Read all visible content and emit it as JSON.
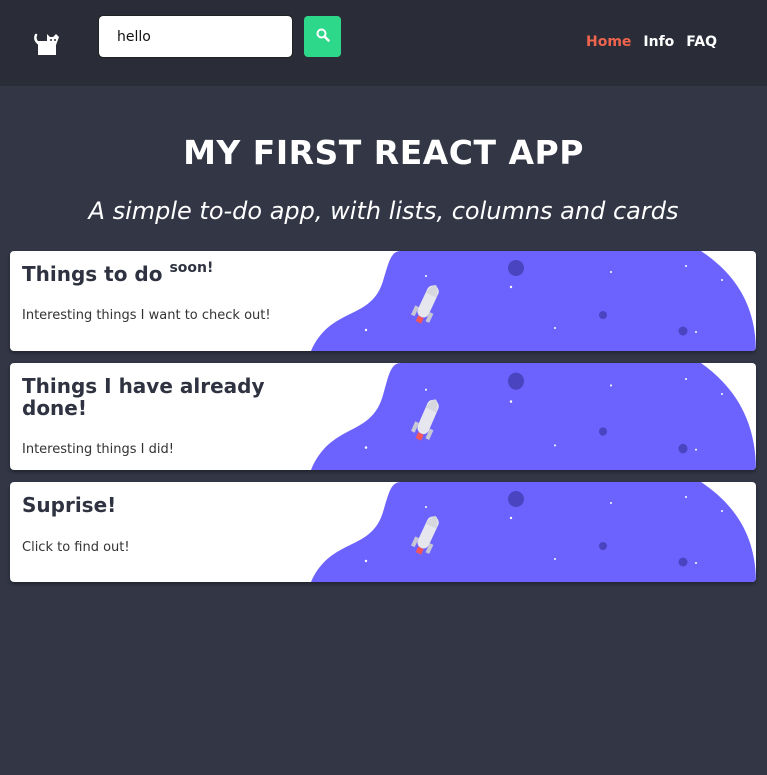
{
  "header": {
    "logo_icon": "cat-icon",
    "search": {
      "value": "hello",
      "placeholder": ""
    },
    "search_button_icon": "search-icon",
    "nav": [
      {
        "label": "Home",
        "active": true
      },
      {
        "label": "Info",
        "active": false
      },
      {
        "label": "FAQ",
        "active": false
      }
    ]
  },
  "main": {
    "title": "MY FIRST REACT APP",
    "subtitle": "A simple to-do app, with lists, columns and cards"
  },
  "cards": [
    {
      "title": "Things to do",
      "superscript": "soon!",
      "description": "Interesting things I want to check out!"
    },
    {
      "title": "Things I have already done!",
      "superscript": "",
      "description": "Interesting things I did!"
    },
    {
      "title": "Suprise!",
      "superscript": "",
      "description": "Click to find out!"
    }
  ],
  "colors": {
    "background": "#323645",
    "header": "#2a2d38",
    "accent_active": "#f0644d",
    "search_button": "#2ed88a",
    "card_art": "#6c63ff"
  }
}
